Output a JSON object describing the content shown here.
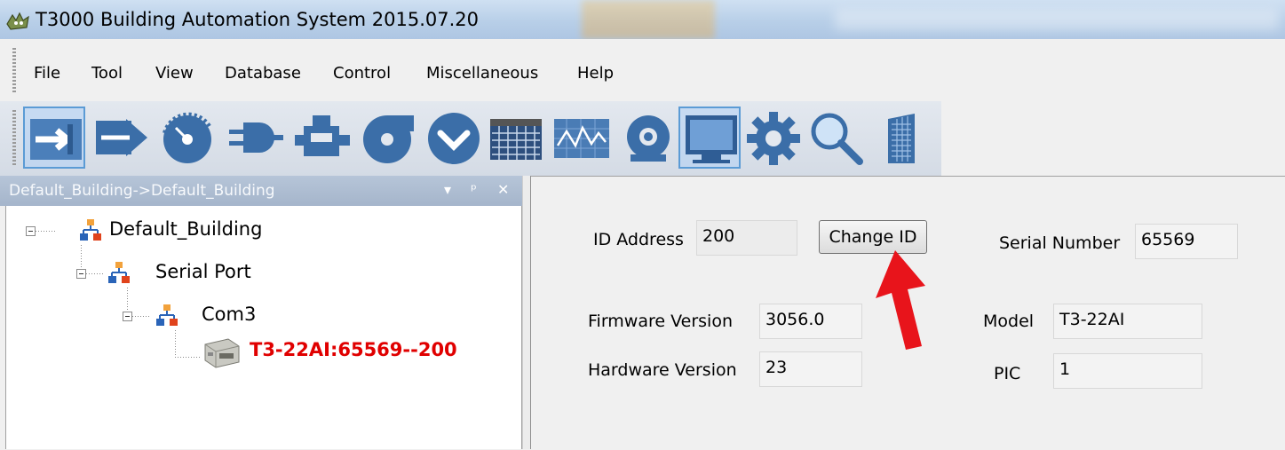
{
  "window": {
    "title": "T3000 Building Automation System 2015.07.20"
  },
  "menu": {
    "items": [
      {
        "label": "File"
      },
      {
        "label": "Tool"
      },
      {
        "label": "View"
      },
      {
        "label": "Database"
      },
      {
        "label": "Control"
      },
      {
        "label": "Miscellaneous"
      },
      {
        "label": "Help"
      }
    ]
  },
  "toolbar": {
    "icons": [
      "connect-arrow-icon",
      "arrow-right-icon",
      "gauge-icon",
      "plug-icon",
      "valve-icon",
      "fan-icon",
      "chevron-circle-icon",
      "calendar-icon",
      "trend-graph-icon",
      "alarm-bell-icon",
      "monitor-icon",
      "gear-icon",
      "search-icon",
      "building-icon"
    ],
    "selected": [
      "connect-arrow-icon",
      "monitor-icon"
    ],
    "accent": "#3b6ea8"
  },
  "panel": {
    "title": "Default_Building->Default_Building",
    "controls": {
      "dropdown": "▾",
      "pin": "ᵖ",
      "close": "✕"
    }
  },
  "tree": {
    "building": "Default_Building",
    "serial_port": "Serial Port",
    "com": "Com3",
    "device": "T3-22AI:65569--200",
    "device_color": "#e00000"
  },
  "form": {
    "id_address_label": "ID Address",
    "id_address_value": "200",
    "change_id_label": "Change ID",
    "serial_number_label": "Serial Number",
    "serial_number_value": "65569",
    "firmware_label": "Firmware Version",
    "firmware_value": "3056.0",
    "hardware_label": "Hardware Version",
    "hardware_value": "23",
    "model_label": "Model",
    "model_value": "T3-22AI",
    "pic_label": "PIC",
    "pic_value": "1"
  }
}
